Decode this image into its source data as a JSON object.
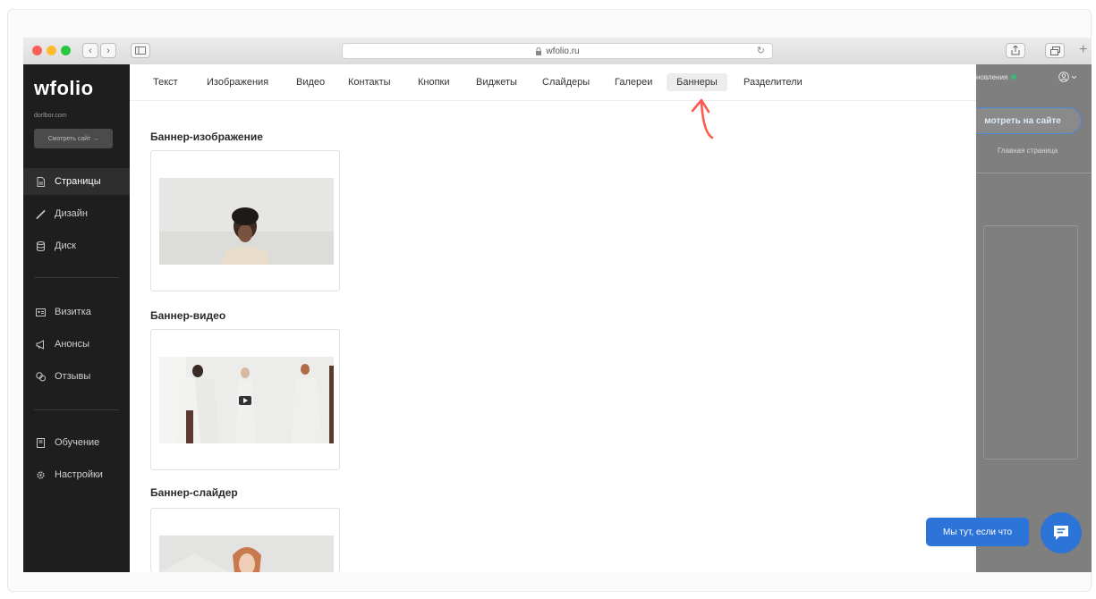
{
  "browser": {
    "url": "wfolio.ru",
    "lock_icon": "lock-icon",
    "reload_icon": "reload-icon"
  },
  "sidebar": {
    "logo": "wfolio",
    "domain": "dorlbor.com",
    "view_site": "Смотреть сайт →",
    "items": [
      {
        "label": "Страницы",
        "icon": "page-icon"
      },
      {
        "label": "Дизайн",
        "icon": "brush-icon"
      },
      {
        "label": "Диск",
        "icon": "disk-icon"
      },
      {
        "label": "Визитка",
        "icon": "card-icon"
      },
      {
        "label": "Анонсы",
        "icon": "megaphone-icon"
      },
      {
        "label": "Отзывы",
        "icon": "chat-icon"
      },
      {
        "label": "Обучение",
        "icon": "book-icon"
      },
      {
        "label": "Настройки",
        "icon": "gear-icon"
      }
    ]
  },
  "tabs": [
    {
      "label": "Текст"
    },
    {
      "label": "Изображения"
    },
    {
      "label": "Видео"
    },
    {
      "label": "Контакты"
    },
    {
      "label": "Кнопки"
    },
    {
      "label": "Виджеты"
    },
    {
      "label": "Слайдеры"
    },
    {
      "label": "Галереи"
    },
    {
      "label": "Баннеры"
    },
    {
      "label": "Разделители"
    }
  ],
  "active_tab": "Баннеры",
  "sections": [
    {
      "title": "Баннер-изображение"
    },
    {
      "title": "Баннер-видео"
    },
    {
      "title": "Баннер-слайдер"
    }
  ],
  "right_panel": {
    "updates": "новления",
    "view_site": "мотреть на сайте",
    "page": "Главная страница"
  },
  "chat": {
    "bubble": "Мы тут, если что"
  },
  "colors": {
    "accent": "#2d74d8",
    "sidebar_bg": "#1e1e1e",
    "arrow": "#ff5a4e",
    "status_dot": "#3cb878"
  }
}
